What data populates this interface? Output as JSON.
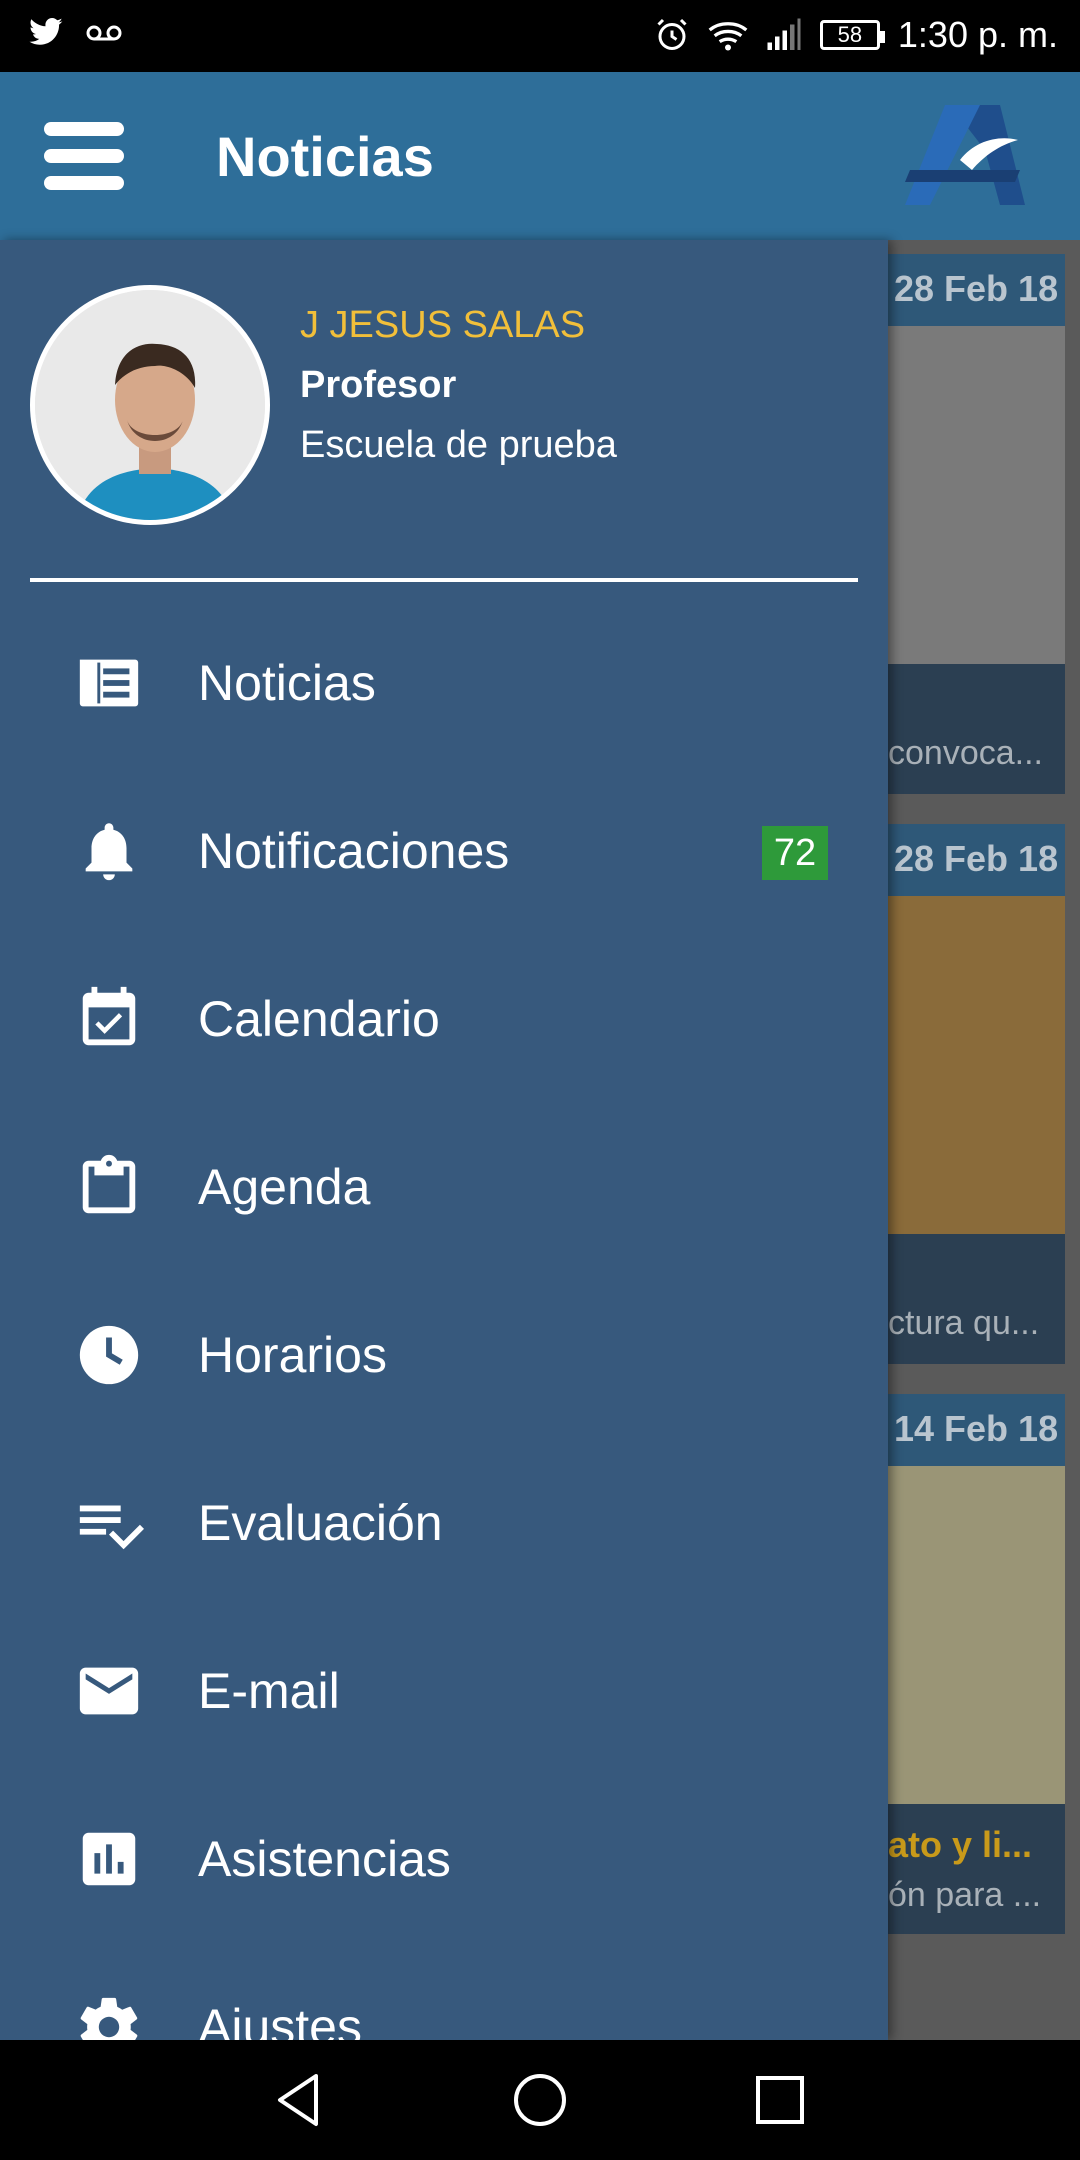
{
  "status_bar": {
    "left_icons": [
      "twitter-icon",
      "voicemail-icon"
    ],
    "battery": "58",
    "time": "1:30 p. m."
  },
  "appbar": {
    "title": "Noticias"
  },
  "background_cards": [
    {
      "date": "28 Feb 18",
      "caption": "convoca..."
    },
    {
      "date": "28 Feb 18",
      "caption": "ctura qu..."
    },
    {
      "date": "14 Feb 18",
      "title": "ato y li...",
      "caption": "ón para ..."
    }
  ],
  "drawer": {
    "user": {
      "name": "J JESUS SALAS",
      "role": "Profesor",
      "school": "Escuela de prueba"
    },
    "items": [
      {
        "label": "Noticias",
        "icon": "newspaper-icon"
      },
      {
        "label": "Notificaciones",
        "icon": "bell-icon",
        "badge": "72"
      },
      {
        "label": "Calendario",
        "icon": "calendar-check-icon"
      },
      {
        "label": "Agenda",
        "icon": "clipboard-icon"
      },
      {
        "label": "Horarios",
        "icon": "clock-icon"
      },
      {
        "label": "Evaluación",
        "icon": "checklist-icon"
      },
      {
        "label": "E-mail",
        "icon": "mail-icon"
      },
      {
        "label": "Asistencias",
        "icon": "bar-chart-icon"
      },
      {
        "label": "Ajustes",
        "icon": "gear-icon"
      }
    ]
  },
  "colors": {
    "appbar": "#2e6e99",
    "drawer": "#37597d",
    "username": "#f1bf3a",
    "badge": "#2e9a3a"
  }
}
